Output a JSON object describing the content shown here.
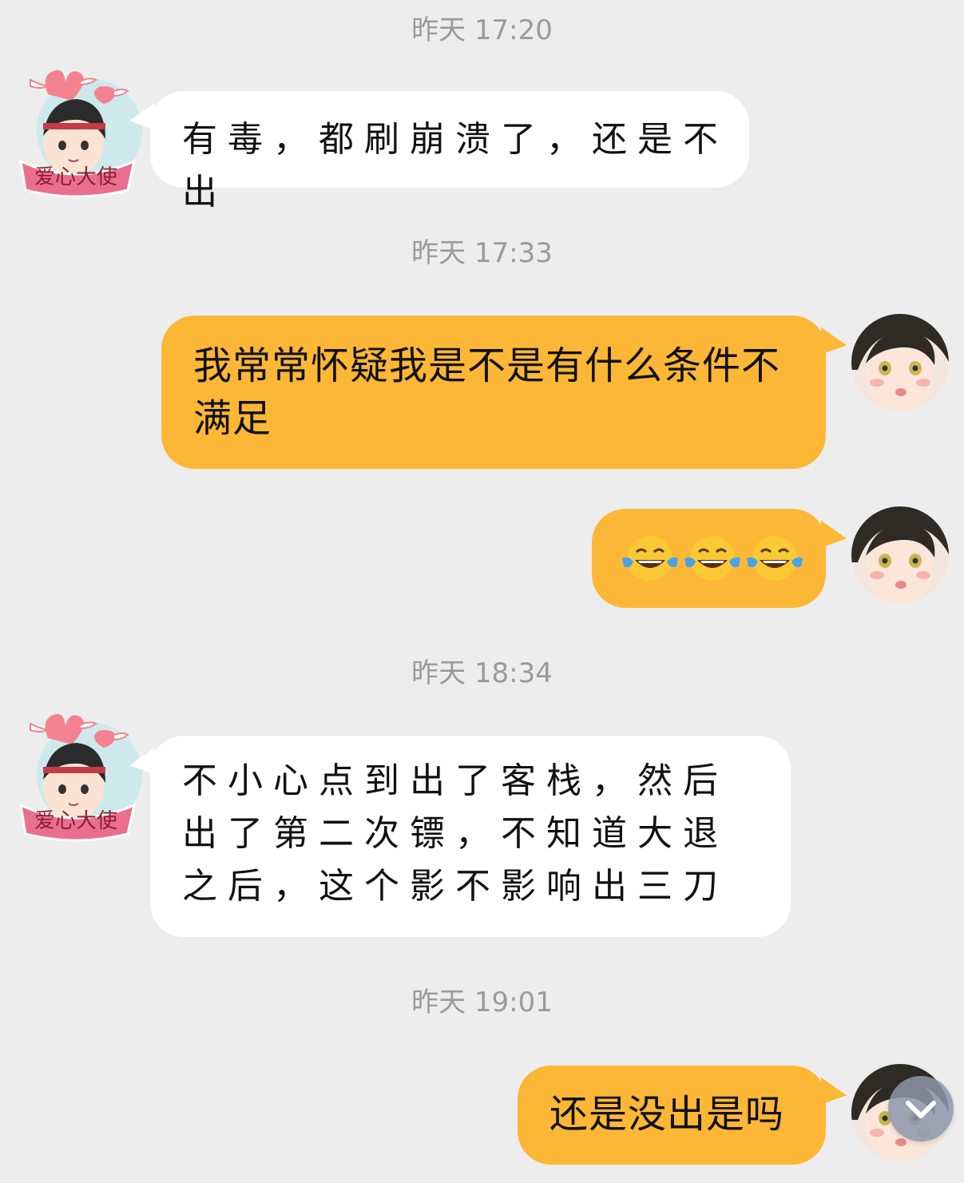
{
  "messages": [
    {
      "time": "昨天 17:20",
      "side": "in",
      "text": "有毒，都刷崩溃了，还是不出"
    },
    {
      "time": "昨天 17:33",
      "side": "out",
      "text": "我常常怀疑我是不是有什么条件不满足"
    },
    {
      "side": "out",
      "text": "😂😂😂",
      "emoji": [
        "tears-of-joy",
        "tears-of-joy",
        "tears-of-joy"
      ]
    },
    {
      "time": "昨天 18:34",
      "side": "in",
      "text": "不小心点到出了客栈，然后出了第二次镖，不知道大退之后，这个影不影响出三刀"
    },
    {
      "time": "昨天 19:01",
      "side": "out",
      "text": "还是没出是吗"
    }
  ],
  "badge": {
    "label": "爱心大使"
  },
  "colors": {
    "background": "#ededed",
    "incoming_bubble": "#ffffff",
    "outgoing_bubble": "#fdb736",
    "timestamp": "#9a9a9a"
  },
  "scroll_button": {
    "icon": "chevron-down-icon"
  }
}
